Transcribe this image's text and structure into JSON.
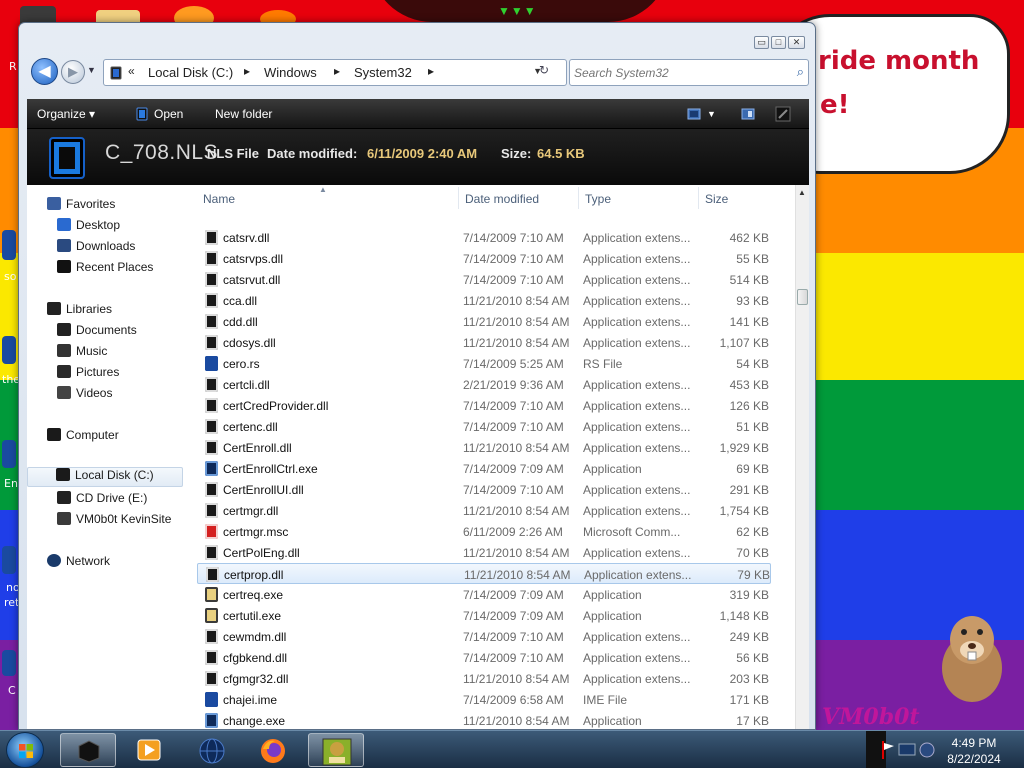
{
  "desktop": {
    "speech_lines": [
      "ride month",
      "e!"
    ],
    "left_edge_labels": [
      "R",
      "so",
      "the",
      "En",
      "no",
      "ret",
      "C"
    ],
    "watermark": "VM0b0t",
    "colors": {
      "red": "#e8000d",
      "orange": "#ff8b00",
      "yellow": "#fbe800",
      "green": "#009a3a",
      "blue": "#1f3ee8",
      "purple": "#7a1fa2"
    }
  },
  "window": {
    "caption_buttons": {
      "minimize": "▭",
      "maximize": "□",
      "close": "✕"
    },
    "nav": {
      "back_arrow": "◀",
      "forward_arrow": "▶",
      "history_arrow": "▼"
    },
    "address": {
      "overflow": "«",
      "segments": [
        "Local Disk (C:)",
        "Windows",
        "System32"
      ],
      "separator": "▸",
      "dropdown": "▼",
      "refresh": "↻"
    },
    "search": {
      "placeholder": "Search System32",
      "icon": "search-icon"
    },
    "toolbar": {
      "organize": "Organize ▾",
      "open": "Open",
      "new_folder": "New folder"
    },
    "details": {
      "file_name": "C_708.NLS",
      "file_type": "NLS File",
      "date_label": "Date modified:",
      "date_value": "6/11/2009 2:40 AM",
      "size_label": "Size:",
      "size_value": "64.5 KB"
    }
  },
  "nav_pane": {
    "favorites": {
      "label": "Favorites",
      "items": [
        "Desktop",
        "Downloads",
        "Recent Places"
      ]
    },
    "libraries": {
      "label": "Libraries",
      "items": [
        "Documents",
        "Music",
        "Pictures",
        "Videos"
      ]
    },
    "computer": {
      "label": "Computer",
      "items": [
        "Local Disk (C:)",
        "CD Drive (E:)",
        "VM0b0t KevinSite"
      ],
      "selected": "Local Disk (C:)"
    },
    "network": {
      "label": "Network"
    }
  },
  "file_list": {
    "columns": {
      "name": "Name",
      "date": "Date modified",
      "type": "Type",
      "size": "Size"
    },
    "rows": [
      {
        "name": "catsrv.dll",
        "date": "7/14/2009 7:10 AM",
        "type": "Application extens...",
        "size": "462 KB",
        "icon": "dll"
      },
      {
        "name": "catsrvps.dll",
        "date": "7/14/2009 7:10 AM",
        "type": "Application extens...",
        "size": "55 KB",
        "icon": "dll"
      },
      {
        "name": "catsrvut.dll",
        "date": "7/14/2009 7:10 AM",
        "type": "Application extens...",
        "size": "514 KB",
        "icon": "dll"
      },
      {
        "name": "cca.dll",
        "date": "11/21/2010 8:54 AM",
        "type": "Application extens...",
        "size": "93 KB",
        "icon": "dll"
      },
      {
        "name": "cdd.dll",
        "date": "11/21/2010 8:54 AM",
        "type": "Application extens...",
        "size": "141 KB",
        "icon": "dll"
      },
      {
        "name": "cdosys.dll",
        "date": "11/21/2010 8:54 AM",
        "type": "Application extens...",
        "size": "1,107 KB",
        "icon": "dll"
      },
      {
        "name": "cero.rs",
        "date": "7/14/2009 5:25 AM",
        "type": "RS File",
        "size": "54 KB",
        "icon": "generic"
      },
      {
        "name": "certcli.dll",
        "date": "2/21/2019 9:36 AM",
        "type": "Application extens...",
        "size": "453 KB",
        "icon": "dll"
      },
      {
        "name": "certCredProvider.dll",
        "date": "7/14/2009 7:10 AM",
        "type": "Application extens...",
        "size": "126 KB",
        "icon": "dll"
      },
      {
        "name": "certenc.dll",
        "date": "7/14/2009 7:10 AM",
        "type": "Application extens...",
        "size": "51 KB",
        "icon": "dll"
      },
      {
        "name": "CertEnroll.dll",
        "date": "11/21/2010 8:54 AM",
        "type": "Application extens...",
        "size": "1,929 KB",
        "icon": "dll"
      },
      {
        "name": "CertEnrollCtrl.exe",
        "date": "7/14/2009 7:09 AM",
        "type": "Application",
        "size": "69 KB",
        "icon": "exe"
      },
      {
        "name": "CertEnrollUI.dll",
        "date": "7/14/2009 7:10 AM",
        "type": "Application extens...",
        "size": "291 KB",
        "icon": "dll"
      },
      {
        "name": "certmgr.dll",
        "date": "11/21/2010 8:54 AM",
        "type": "Application extens...",
        "size": "1,754 KB",
        "icon": "dll"
      },
      {
        "name": "certmgr.msc",
        "date": "6/11/2009 2:26 AM",
        "type": "Microsoft Comm...",
        "size": "62 KB",
        "icon": "msc"
      },
      {
        "name": "CertPolEng.dll",
        "date": "11/21/2010 8:54 AM",
        "type": "Application extens...",
        "size": "70 KB",
        "icon": "dll"
      },
      {
        "name": "certprop.dll",
        "date": "11/21/2010 8:54 AM",
        "type": "Application extens...",
        "size": "79 KB",
        "icon": "dll",
        "selected": true
      },
      {
        "name": "certreq.exe",
        "date": "7/14/2009 7:09 AM",
        "type": "Application",
        "size": "319 KB",
        "icon": "cert"
      },
      {
        "name": "certutil.exe",
        "date": "7/14/2009 7:09 AM",
        "type": "Application",
        "size": "1,148 KB",
        "icon": "cert"
      },
      {
        "name": "cewmdm.dll",
        "date": "7/14/2009 7:10 AM",
        "type": "Application extens...",
        "size": "249 KB",
        "icon": "dll"
      },
      {
        "name": "cfgbkend.dll",
        "date": "7/14/2009 7:10 AM",
        "type": "Application extens...",
        "size": "56 KB",
        "icon": "dll"
      },
      {
        "name": "cfgmgr32.dll",
        "date": "11/21/2010 8:54 AM",
        "type": "Application extens...",
        "size": "203 KB",
        "icon": "dll"
      },
      {
        "name": "chajei.ime",
        "date": "7/14/2009 6:58 AM",
        "type": "IME File",
        "size": "171 KB",
        "icon": "generic"
      },
      {
        "name": "change.exe",
        "date": "11/21/2010 8:54 AM",
        "type": "Application",
        "size": "17 KB",
        "icon": "exe"
      }
    ]
  },
  "taskbar": {
    "time": "4:49 PM",
    "date": "8/22/2024",
    "pinned": [
      "explorer-window",
      "media-player",
      "globe-browser",
      "firefox",
      "box-game"
    ]
  }
}
